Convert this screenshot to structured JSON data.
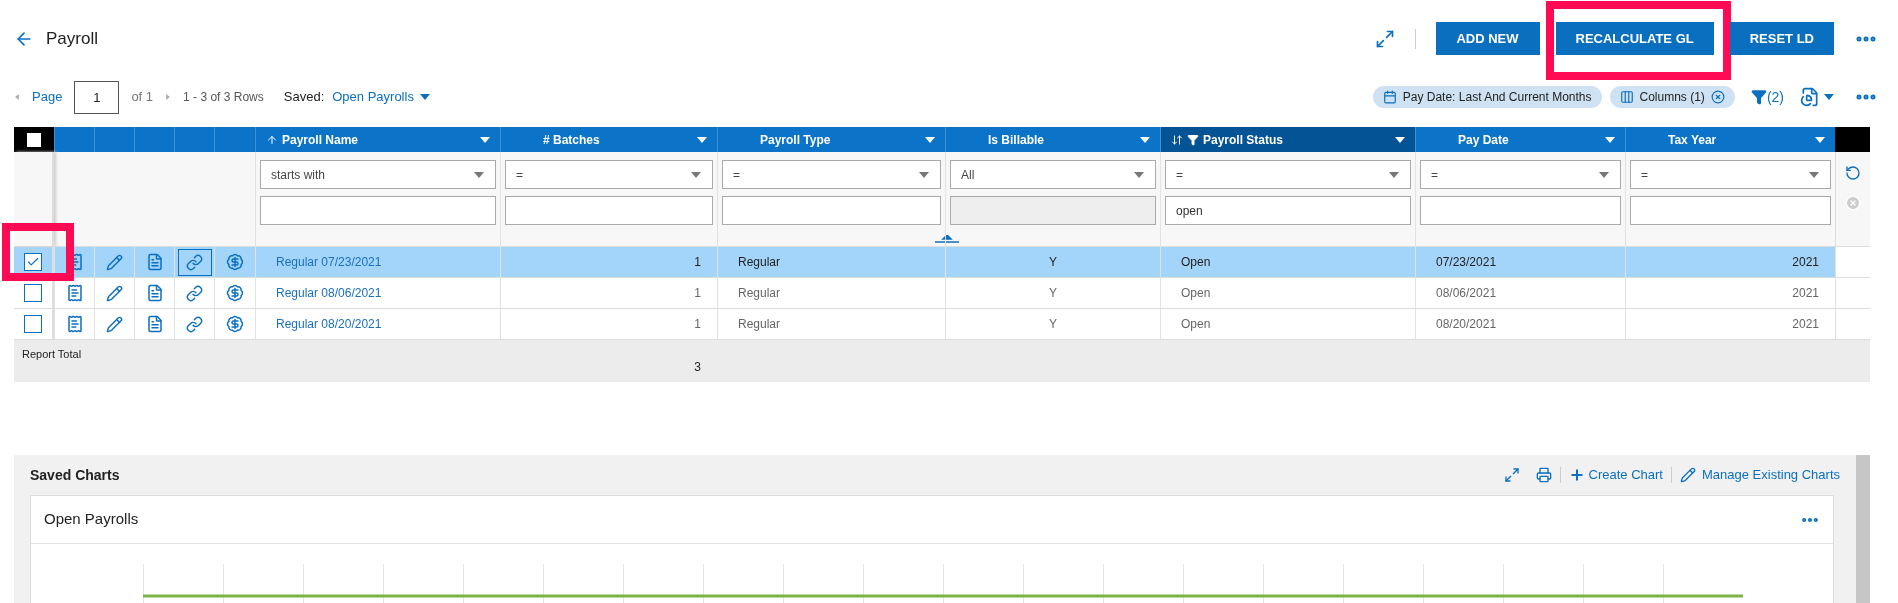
{
  "page_title": "Payroll",
  "actions": [
    {
      "label": "ADD NEW",
      "highlighted": false
    },
    {
      "label": "RECALCULATE GL",
      "highlighted": true
    },
    {
      "label": "RESET LD",
      "highlighted": false
    }
  ],
  "pager": {
    "page_label": "Page",
    "page": "1",
    "of": "of 1",
    "rows": "1 - 3 of 3 Rows",
    "saved_label": "Saved:",
    "saved_view": "Open Payrolls"
  },
  "chips": [
    {
      "label": "Pay Date: Last And Current Months",
      "kind": "calendar",
      "removable": false
    },
    {
      "label": "Columns (1)",
      "kind": "columns",
      "removable": true
    }
  ],
  "filter_count": "(2)",
  "table": {
    "select_all_checked": false,
    "columns": [
      {
        "label": "Payroll Name",
        "sorted": true,
        "sort_toggle": false,
        "filtered": false,
        "operator": "starts with",
        "disabled": false
      },
      {
        "label": "# Batches",
        "sorted": false,
        "sort_toggle": false,
        "filtered": false,
        "operator": "=",
        "disabled": false
      },
      {
        "label": "Payroll Type",
        "sorted": false,
        "sort_toggle": false,
        "filtered": false,
        "operator": "=",
        "disabled": false
      },
      {
        "label": "Is Billable",
        "sorted": false,
        "sort_toggle": false,
        "filtered": false,
        "operator": "All",
        "disabled": true
      },
      {
        "label": "Payroll Status",
        "sorted": false,
        "sort_toggle": true,
        "filtered": true,
        "operator": "=",
        "value": "open",
        "disabled": false
      },
      {
        "label": "Pay Date",
        "sorted": false,
        "sort_toggle": false,
        "filtered": false,
        "operator": "=",
        "disabled": false
      },
      {
        "label": "Tax Year",
        "sorted": false,
        "sort_toggle": false,
        "filtered": false,
        "operator": "=",
        "disabled": false
      }
    ],
    "rows": [
      {
        "selected": true,
        "checked": true,
        "highlighted": true,
        "cells": [
          "Regular 07/23/2021",
          "1",
          "Regular",
          "Y",
          "Open",
          "07/23/2021",
          "2021"
        ]
      },
      {
        "selected": false,
        "checked": false,
        "highlighted": false,
        "cells": [
          "Regular 08/06/2021",
          "1",
          "Regular",
          "Y",
          "Open",
          "08/06/2021",
          "2021"
        ]
      },
      {
        "selected": false,
        "checked": false,
        "highlighted": false,
        "cells": [
          "Regular 08/20/2021",
          "1",
          "Regular",
          "Y",
          "Open",
          "08/20/2021",
          "2021"
        ]
      }
    ],
    "report_total_label": "Report Total",
    "total_batches": "3"
  },
  "saved_charts": {
    "title": "Saved Charts",
    "create_label": "Create Chart",
    "manage_label": "Manage Existing Charts",
    "chart_title": "Open Payrolls"
  }
}
